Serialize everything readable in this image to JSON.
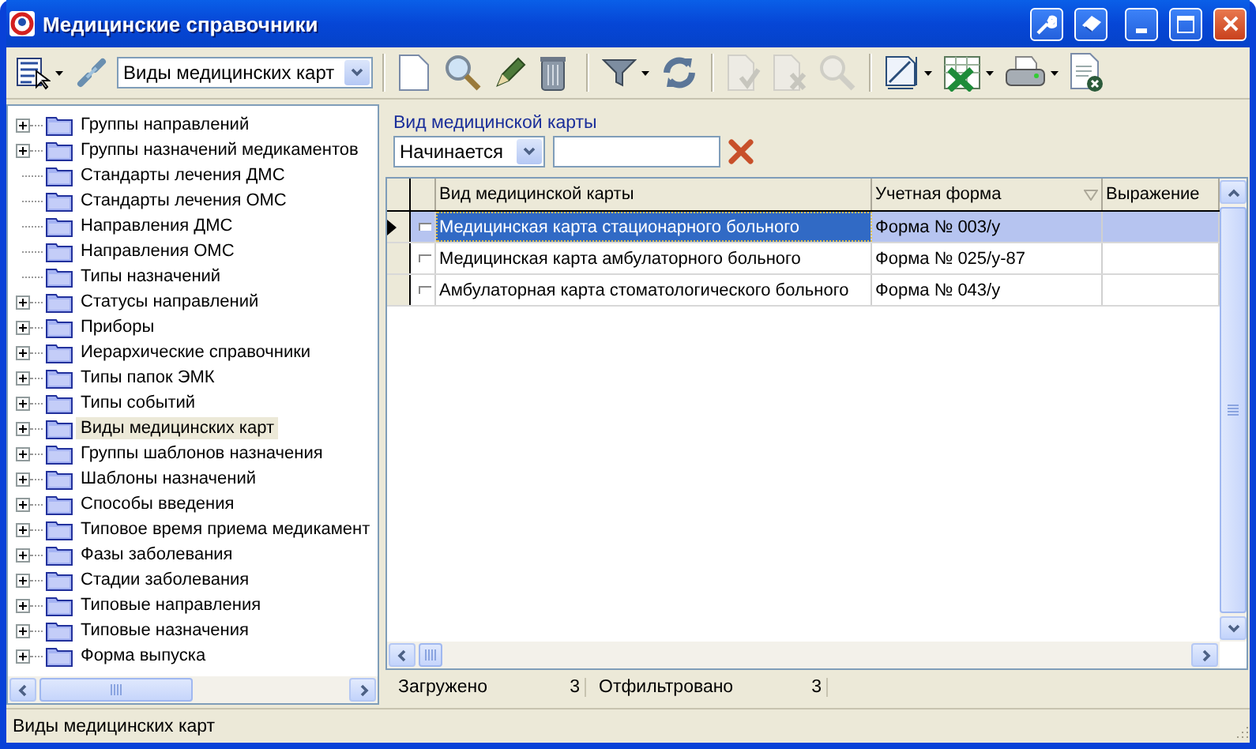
{
  "window": {
    "title": "Медицинские справочники"
  },
  "toolbar": {
    "view_select": "Виды медицинских карт",
    "buttons": [
      {
        "kind": "new",
        "disabled": false,
        "menu": false
      },
      {
        "kind": "find",
        "disabled": false,
        "menu": false
      },
      {
        "kind": "edit",
        "disabled": false,
        "menu": false
      },
      {
        "kind": "delete",
        "disabled": false,
        "menu": false
      },
      {
        "kind": "separator"
      },
      {
        "kind": "filter",
        "disabled": false,
        "menu": true
      },
      {
        "kind": "refresh",
        "disabled": false,
        "menu": false
      },
      {
        "kind": "separator"
      },
      {
        "kind": "accept",
        "disabled": true,
        "menu": false
      },
      {
        "kind": "reject",
        "disabled": true,
        "menu": false
      },
      {
        "kind": "find",
        "disabled": true,
        "menu": false
      },
      {
        "kind": "separator"
      },
      {
        "kind": "resize",
        "disabled": false,
        "menu": true
      },
      {
        "kind": "excel",
        "disabled": false,
        "menu": true
      },
      {
        "kind": "print",
        "disabled": false,
        "menu": true
      },
      {
        "kind": "close-doc",
        "disabled": false,
        "menu": false
      }
    ]
  },
  "tree": {
    "items": [
      {
        "label": "Группы направлений",
        "expandable": true,
        "selected": false
      },
      {
        "label": "Группы назначений медикаментов",
        "expandable": true,
        "selected": false
      },
      {
        "label": "Стандарты лечения ДМС",
        "expandable": false,
        "selected": false
      },
      {
        "label": "Стандарты лечения ОМС",
        "expandable": false,
        "selected": false
      },
      {
        "label": "Направления ДМС",
        "expandable": false,
        "selected": false
      },
      {
        "label": "Направления ОМС",
        "expandable": false,
        "selected": false
      },
      {
        "label": "Типы назначений",
        "expandable": false,
        "selected": false
      },
      {
        "label": "Статусы направлений",
        "expandable": true,
        "selected": false
      },
      {
        "label": "Приборы",
        "expandable": true,
        "selected": false
      },
      {
        "label": "Иерархические справочники",
        "expandable": true,
        "selected": false
      },
      {
        "label": "Типы папок ЭМК",
        "expandable": true,
        "selected": false
      },
      {
        "label": "Типы событий",
        "expandable": true,
        "selected": false
      },
      {
        "label": "Виды медицинских карт",
        "expandable": true,
        "selected": true
      },
      {
        "label": "Группы шаблонов назначения",
        "expandable": true,
        "selected": false
      },
      {
        "label": "Шаблоны назначений",
        "expandable": true,
        "selected": false
      },
      {
        "label": "Способы введения",
        "expandable": true,
        "selected": false
      },
      {
        "label": "Типовое время приема медикамент",
        "expandable": true,
        "selected": false
      },
      {
        "label": "Фазы заболевания",
        "expandable": true,
        "selected": false
      },
      {
        "label": "Стадии заболевания",
        "expandable": true,
        "selected": false
      },
      {
        "label": "Типовые направления",
        "expandable": true,
        "selected": false
      },
      {
        "label": "Типовые назначения",
        "expandable": true,
        "selected": false
      },
      {
        "label": "Форма выпуска",
        "expandable": true,
        "selected": false
      }
    ]
  },
  "filter": {
    "label": "Вид медицинской карты",
    "mode": "Начинается"
  },
  "grid": {
    "columns": [
      {
        "label": "Вид медицинской карты",
        "sorted": false
      },
      {
        "label": "Учетная форма",
        "sorted": true
      },
      {
        "label": "Выражение",
        "sorted": false
      }
    ],
    "rows": [
      {
        "cells": [
          "Медицинская карта стационарного больного",
          "Форма № 003/у",
          ""
        ],
        "selected": true
      },
      {
        "cells": [
          "Медицинская карта амбулаторного больного",
          "Форма № 025/у-87",
          ""
        ],
        "selected": false
      },
      {
        "cells": [
          "Амбулаторная карта стоматологического больного",
          "Форма № 043/у",
          ""
        ],
        "selected": false
      }
    ]
  },
  "grid_status": {
    "loaded_label": "Загружено",
    "loaded": "3",
    "filtered_label": "Отфильтровано",
    "filtered": "3"
  },
  "status_bar": "Виды медицинских карт"
}
